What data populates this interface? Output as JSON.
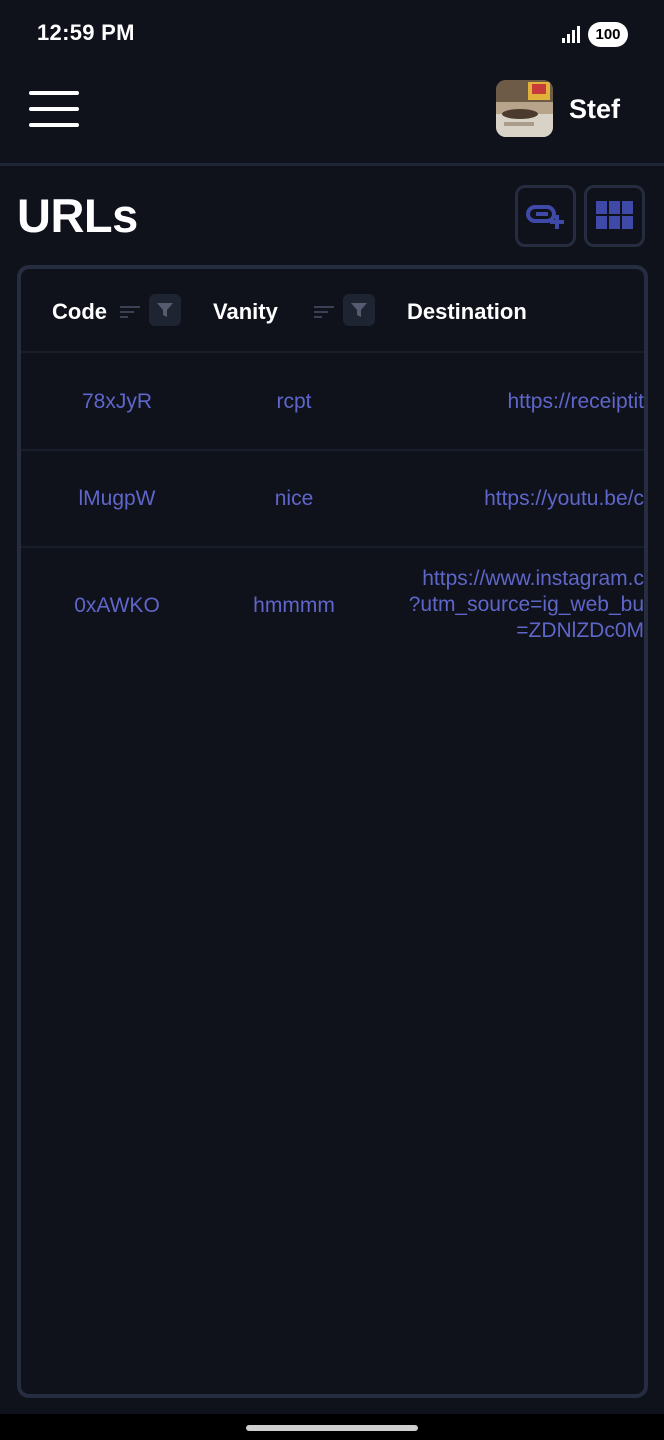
{
  "status_bar": {
    "time": "12:59 PM",
    "battery": "100"
  },
  "header": {
    "user_name": "Stef"
  },
  "page": {
    "title": "URLs"
  },
  "table": {
    "columns": [
      "Code",
      "Vanity",
      "Destination"
    ],
    "rows": [
      {
        "code": "78xJyR",
        "vanity": "rcpt",
        "destination": "https://receiptit"
      },
      {
        "code": "lMugpW",
        "vanity": "nice",
        "destination": "https://youtu.be/c"
      },
      {
        "code": "0xAWKO",
        "vanity": "hmmmm",
        "destination": "https://www.instagram.c\n?utm_source=ig_web_bu\n=ZDNlZDc0M"
      }
    ]
  },
  "colors": {
    "background": "#0f111b",
    "border": "#262d40",
    "link": "#5f66c9",
    "icon_accent": "#3f4aa8"
  }
}
